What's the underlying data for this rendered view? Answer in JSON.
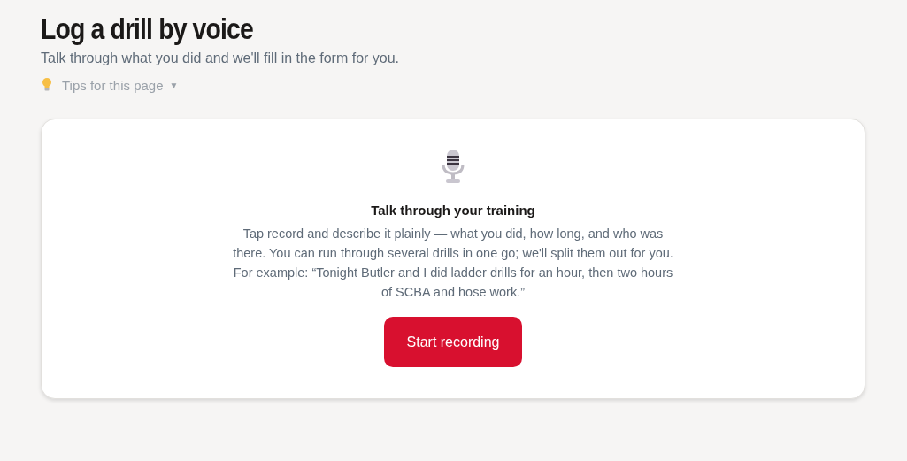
{
  "page": {
    "title": "Log a drill by voice",
    "subtitle": "Talk through what you did and we'll fill in the form for you.",
    "tips": {
      "label": "Tips for this page",
      "caret": "▼"
    }
  },
  "card": {
    "heading": "Talk through your training",
    "description": "Tap record and describe it plainly — what you did, how long, and who was there. You can run through several drills in one go; we'll split them out for you. For example: “Tonight Butler and I did ladder drills for an hour, then two hours of SCBA and hose work.”",
    "button": "Start recording"
  }
}
